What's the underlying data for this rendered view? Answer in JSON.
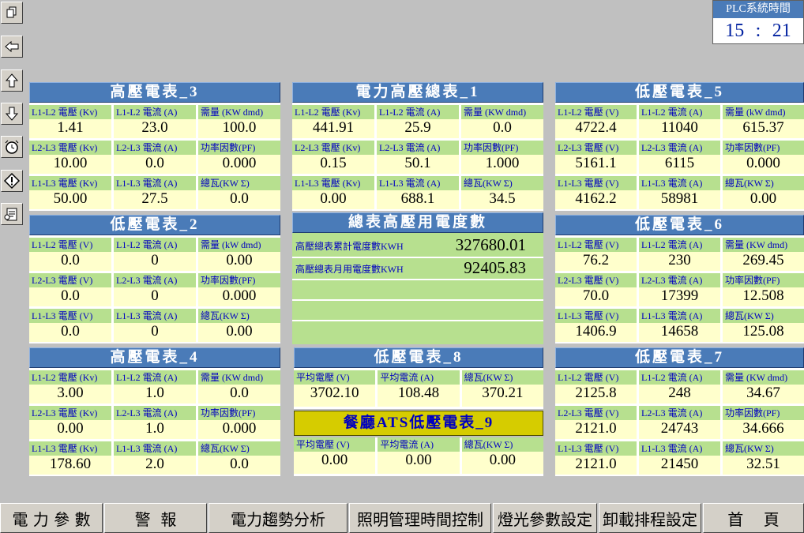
{
  "plc": {
    "title": "PLC系統時間",
    "hour": "15",
    "sep": ":",
    "minute": "21"
  },
  "labels": {
    "v12": "L1-L2 電壓 (V)",
    "v23": "L2-L3 電壓 (V)",
    "v13": "L1-L3 電壓 (V)",
    "kv12": "L1-L2 電壓 (Kv)",
    "kv23": "L2-L3 電壓 (Kv)",
    "kv13": "L1-L3 電壓 (Kv)",
    "i12": "L1-L2 電流 (A)",
    "i23": "L2-L3 電流 (A)",
    "i13": "L1-L3 電流 (A)",
    "dmd_KW": "需量 (KW dmd)",
    "dmd_kW": "需量 (kW dmd)",
    "pf": "功率因數(PF)",
    "kwsum": "總瓦(KW Σ)",
    "avgv": "平均電壓 (V)",
    "avgi": "平均電流 (A)"
  },
  "meters": {
    "hv3": {
      "title": "高壓電表_3",
      "v": [
        "1.41",
        "23.0",
        "100.0",
        "10.00",
        "0.0",
        "0.000",
        "50.00",
        "27.5",
        "0.0"
      ]
    },
    "lv2": {
      "title": "低壓電表_2",
      "v": [
        "0.0",
        "0",
        "0.00",
        "0.0",
        "0",
        "0.000",
        "0.0",
        "0",
        "0.00"
      ]
    },
    "hv4": {
      "title": "高壓電表_4",
      "v": [
        "3.00",
        "1.0",
        "0.0",
        "0.00",
        "1.0",
        "0.000",
        "178.60",
        "2.0",
        "0.0"
      ]
    },
    "main1": {
      "title": "電力高壓總表_1",
      "v": [
        "441.91",
        "25.9",
        "0.0",
        "0.15",
        "50.1",
        "1.000",
        "0.00",
        "688.1",
        "34.5"
      ]
    },
    "lv5": {
      "title": "低壓電表_5",
      "v": [
        "4722.4",
        "11040",
        "615.37",
        "5161.1",
        "6115",
        "0.000",
        "4162.2",
        "58981",
        "0.00"
      ]
    },
    "lv6": {
      "title": "低壓電表_6",
      "v": [
        "76.2",
        "230",
        "269.45",
        "70.0",
        "17399",
        "12.508",
        "1406.9",
        "14658",
        "125.08"
      ]
    },
    "lv7": {
      "title": "低壓電表_7",
      "v": [
        "2125.8",
        "248",
        "34.67",
        "2121.0",
        "24743",
        "34.666",
        "2121.0",
        "21450",
        "32.51"
      ]
    },
    "lv8": {
      "title": "低壓電表_8",
      "v": [
        "3702.10",
        "108.48",
        "370.21"
      ]
    },
    "ats9": {
      "title": "餐廳ATS低壓電表_9",
      "v": [
        "0.00",
        "0.00",
        "0.00"
      ]
    }
  },
  "summary": {
    "title": "總表高壓用電度數",
    "total_label": "高壓總表累計電度數KWH",
    "total_value": "327680.01",
    "month_label": "高壓總表月用電度數KWH",
    "month_value": "92405.83"
  },
  "nav": {
    "power": "電 力 參 數",
    "alarm": "警  報",
    "trend": "電力趨勢分析",
    "lighting": "照明管理時間控制",
    "lightparam": "燈光參數設定",
    "shed": "卸載排程設定",
    "home": "首    頁"
  }
}
